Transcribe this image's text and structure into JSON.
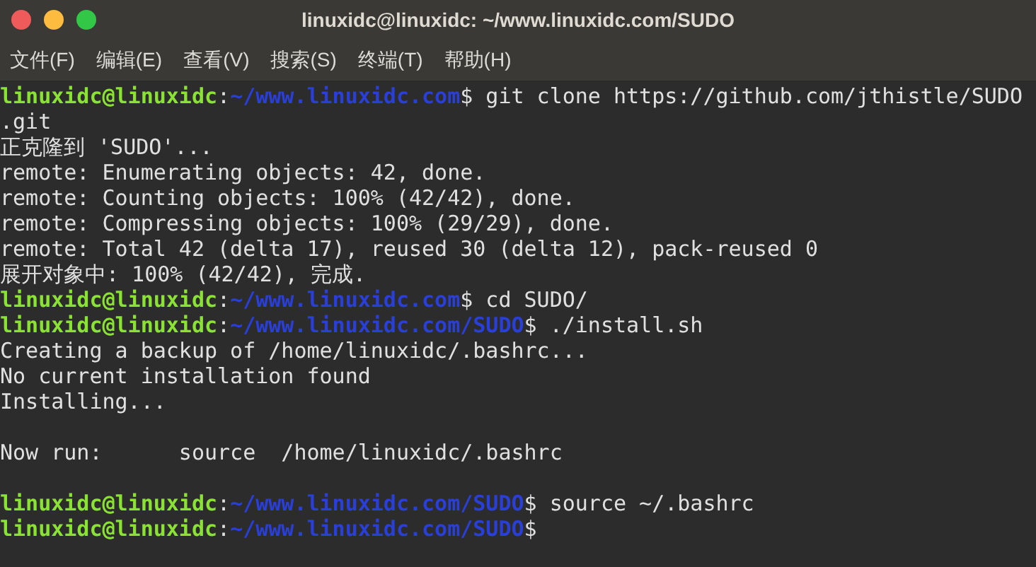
{
  "window": {
    "title": "linuxidc@linuxidc: ~/www.linuxidc.com/SUDO"
  },
  "menu": [
    "文件(F)",
    "编辑(E)",
    "查看(V)",
    "搜索(S)",
    "终端(T)",
    "帮助(H)"
  ],
  "terminal": {
    "lines": [
      {
        "kind": "prompt",
        "user": "linuxidc@linuxidc",
        "sep": ":",
        "path": "~/www.linuxidc.com",
        "command": "$ git clone https://github.com/jthistle/SUDO"
      },
      {
        "kind": "output",
        "text": ".git"
      },
      {
        "kind": "output",
        "text": "正克隆到 'SUDO'..."
      },
      {
        "kind": "output",
        "text": "remote: Enumerating objects: 42, done."
      },
      {
        "kind": "output",
        "text": "remote: Counting objects: 100% (42/42), done."
      },
      {
        "kind": "output",
        "text": "remote: Compressing objects: 100% (29/29), done."
      },
      {
        "kind": "output",
        "text": "remote: Total 42 (delta 17), reused 30 (delta 12), pack-reused 0"
      },
      {
        "kind": "output",
        "text": "展开对象中: 100% (42/42), 完成."
      },
      {
        "kind": "prompt",
        "user": "linuxidc@linuxidc",
        "sep": ":",
        "path": "~/www.linuxidc.com",
        "command": "$ cd SUDO/"
      },
      {
        "kind": "prompt",
        "user": "linuxidc@linuxidc",
        "sep": ":",
        "path": "~/www.linuxidc.com/SUDO",
        "command": "$ ./install.sh"
      },
      {
        "kind": "output",
        "text": "Creating a backup of /home/linuxidc/.bashrc..."
      },
      {
        "kind": "output",
        "text": "No current installation found"
      },
      {
        "kind": "output",
        "text": "Installing..."
      },
      {
        "kind": "blank"
      },
      {
        "kind": "output",
        "text": "Now run:      source  /home/linuxidc/.bashrc"
      },
      {
        "kind": "blank"
      },
      {
        "kind": "prompt",
        "user": "linuxidc@linuxidc",
        "sep": ":",
        "path": "~/www.linuxidc.com/SUDO",
        "command": "$ source ~/.bashrc"
      },
      {
        "kind": "prompt",
        "user": "linuxidc@linuxidc",
        "sep": ":",
        "path": "~/www.linuxidc.com/SUDO",
        "command": "$"
      }
    ]
  }
}
